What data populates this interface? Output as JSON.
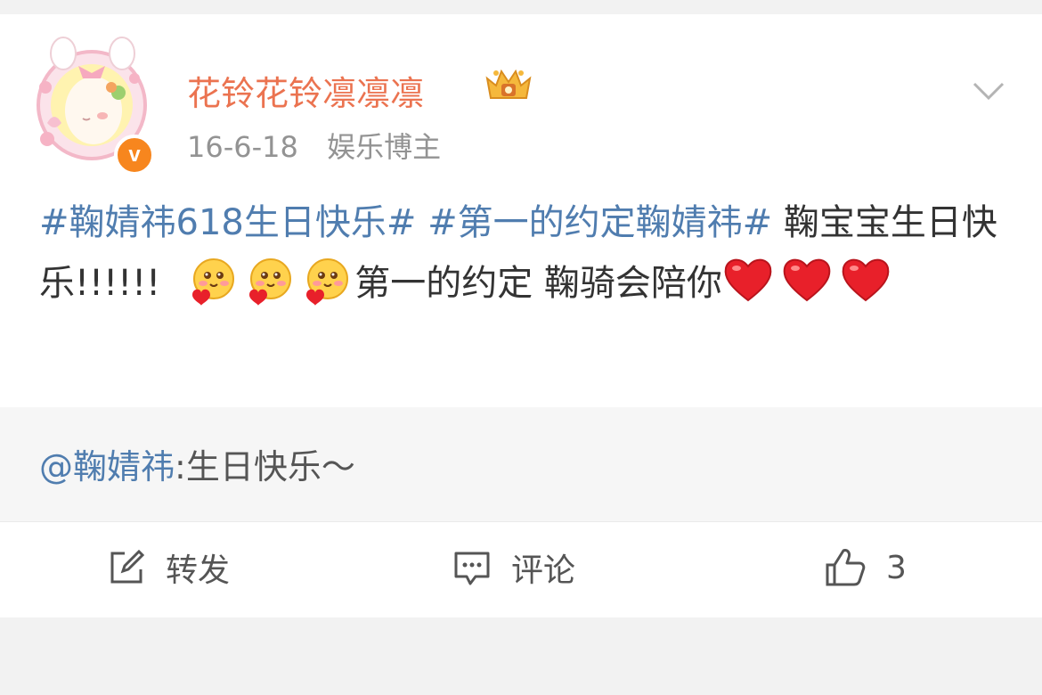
{
  "post": {
    "username": "花铃花铃凛凛凛",
    "date": "16-6-18",
    "source": "娱乐博主",
    "text": {
      "topic1": "#鞠婧祎618生日快乐#",
      "topic2": "#第一的约定鞠婧祎#",
      "part1": " 鞠宝宝生日快乐!!!!!!",
      "part2": "第一的约定 鞠骑会陪你"
    },
    "verified_badge": "v"
  },
  "quote": {
    "mention": "@鞠婧祎",
    "text": ":生日快乐～"
  },
  "actions": {
    "repost_label": "转发",
    "comment_label": "评论",
    "like_count": "3"
  },
  "icons": {
    "avatar": "anime-girl-avatar",
    "vip": "crown-icon",
    "menu": "chevron-down-icon",
    "emoji": "shy-face-emoji",
    "heart": "red-heart-emoji",
    "repost": "edit-square-icon",
    "comment": "comment-bubble-icon",
    "like": "thumbs-up-icon"
  },
  "colors": {
    "username": "#eb7350",
    "link": "#507daf",
    "verified": "#f7861e",
    "meta": "#939393"
  }
}
